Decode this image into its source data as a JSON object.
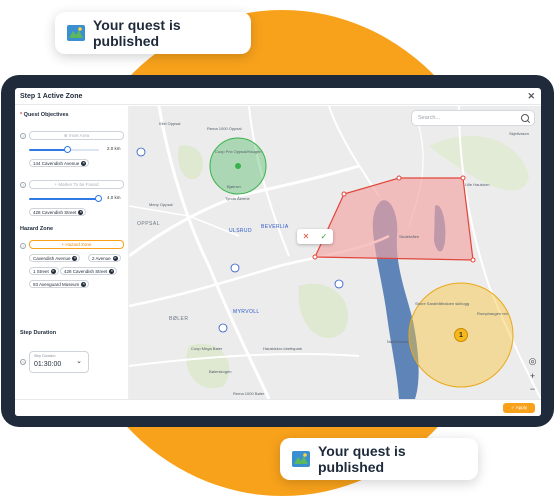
{
  "toasts": {
    "top": "Your quest is published",
    "bottom": "Your quest is published",
    "icon": "map-icon"
  },
  "app": {
    "title": "Step 1 Active Zone",
    "close_icon": "close-icon"
  },
  "sidebar": {
    "objectives": {
      "label": "Quest Objectives",
      "required_mark": "*",
      "slot1": {
        "button": "⊕ Inset Area",
        "slider_value": "2.0 km",
        "slider_fraction": 0.55,
        "chips": [
          "144 Cavendish Avenue"
        ]
      },
      "slot2": {
        "button": "+ Marker To be Found",
        "slider_value": "4.0 km",
        "slider_fraction": 1.0,
        "chips": [
          "428 Cavendish Street"
        ]
      }
    },
    "hazard": {
      "label": "Hazard Zone",
      "button": "+ Hazard Zone",
      "chips": [
        "Cavendish Avenue",
        "2 Avenue",
        "1 Street",
        "428 Cavendish Street",
        "93 Avenguard Museum"
      ]
    },
    "duration": {
      "label": "Step Duration",
      "field_label": "Step Duration",
      "value": "01:30:00"
    }
  },
  "map": {
    "search_placeholder": "Search...",
    "labels": {
      "kileloppe": "Kilel Oppsal",
      "rema": "Rema 1000 Oppsal",
      "coop": "Coop Prix Oppsal/Haugen",
      "bjornvn": "Bjørnvn",
      "tynda": "Tynda Åkrene",
      "meny": "Meny Oppsal",
      "oppsal": "OPPSAL",
      "ulsrud": "ULSRUD",
      "beverlia": "BEVERLIA",
      "lille": "Lille Hauktorn",
      "skulekra": "Skulekråen",
      "boler": "BØLER",
      "myrvoll": "MYRVOLL",
      "coopmega": "Coop Mega Bøler",
      "haraldsko": "Haraldskro idrettspark",
      "bolerskogen": "Bølerskogen",
      "rema2": "Rema 1000 Bøler",
      "shore": "Shore Sarabråthaloen skihogg",
      "rumphaugen": "Rumphaugen ren",
      "nokkelvann": "Nøkkelvann",
      "staalverkan": "Skjellvasvn"
    },
    "cluster_count": "1",
    "confirm": {
      "cancel": "✕",
      "ok": "✓"
    },
    "controls": [
      "locate-icon",
      "zoom-in-icon",
      "zoom-out-icon"
    ]
  },
  "footer": {
    "apply_label": "✓ Apply"
  },
  "colors": {
    "accent": "#f8a21b",
    "frame": "#1f2b3b",
    "hazard_fill": "#f2a3a3",
    "hazard_stroke": "#e0463b",
    "objective_green": "#37b24d",
    "lake": "#5f84b8"
  }
}
